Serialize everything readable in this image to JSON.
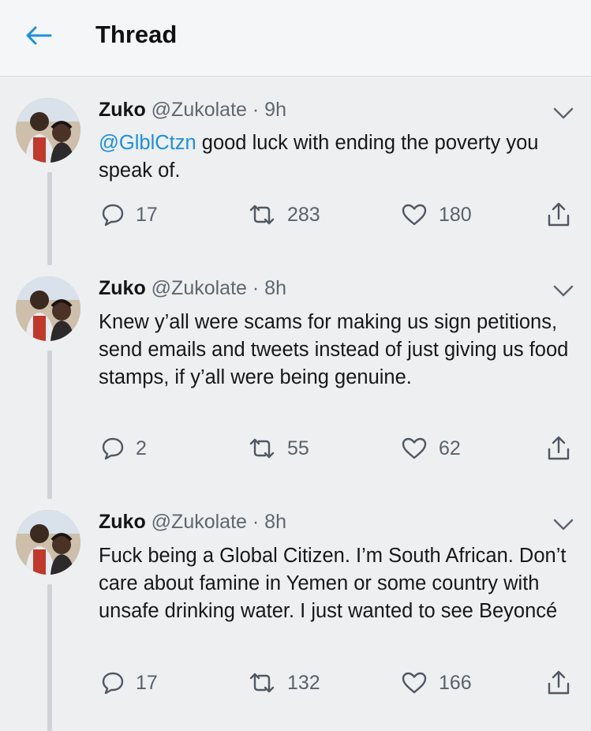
{
  "header": {
    "title": "Thread"
  },
  "tweets": [
    {
      "name": "Zuko",
      "handle": "@Zukolate",
      "separator": "·",
      "time": "9h",
      "mention": "@GlblCtzn",
      "text": "good luck with ending the poverty you speak of.",
      "replies": "17",
      "retweets": "283",
      "likes": "180"
    },
    {
      "name": "Zuko",
      "handle": "@Zukolate",
      "separator": "·",
      "time": "8h",
      "text": "Knew y’all were scams for making us sign petitions, send emails and tweets instead of just giving us food stamps, if y’all were being genuine.",
      "replies": "2",
      "retweets": "55",
      "likes": "62"
    },
    {
      "name": "Zuko",
      "handle": "@Zukolate",
      "separator": "·",
      "time": "8h",
      "text": "Fuck being a Global Citizen. I’m South African. Don’t care about famine in Yemen or some country with unsafe drinking water. I just wanted to see Beyoncé",
      "replies": "17",
      "retweets": "132",
      "likes": "166"
    }
  ],
  "colors": {
    "accent": "#1b90e0",
    "icon": "#4f5862",
    "thread_line": "#cfd3d7"
  },
  "icons": [
    "back-arrow-icon",
    "chevron-down-icon",
    "reply-icon",
    "retweet-icon",
    "like-icon",
    "share-icon"
  ]
}
